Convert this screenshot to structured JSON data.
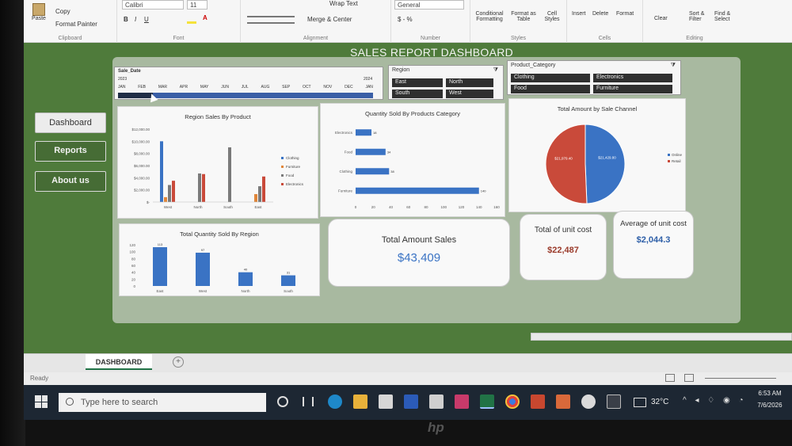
{
  "ribbon": {
    "clipboard": {
      "paste": "Paste",
      "copy": "Copy",
      "format_painter": "Format Painter",
      "label": "Clipboard"
    },
    "font": {
      "name": "Calibri",
      "size": "11",
      "label": "Font"
    },
    "alignment": {
      "wrap": "Wrap Text",
      "merge": "Merge & Center",
      "label": "Alignment"
    },
    "number": {
      "format": "General",
      "label": "Number"
    },
    "styles": {
      "conditional": "Conditional Formatting",
      "format_table": "Format as Table",
      "cell_styles": "Cell Styles",
      "label": "Styles"
    },
    "cells": {
      "insert": "Insert",
      "delete": "Delete",
      "format": "Format",
      "label": "Cells"
    },
    "editing": {
      "clear": "Clear",
      "sort": "Sort & Filter",
      "find": "Find & Select",
      "label": "Editing"
    }
  },
  "dashboard_title": "SALES REPORT DASHBOARD",
  "nav": [
    {
      "label": "Dashboard"
    },
    {
      "label": "Reports"
    },
    {
      "label": "About us"
    }
  ],
  "timeline": {
    "field": "Sale_Date",
    "year_left": "2023",
    "year_right": "2024",
    "months": [
      "JAN",
      "FEB",
      "MAR",
      "APR",
      "MAY",
      "JUN",
      "JUL",
      "AUG",
      "SEP",
      "OCT",
      "NOV",
      "DEC",
      "JAN"
    ]
  },
  "region_slicer": {
    "title": "Region",
    "items": [
      "East",
      "North",
      "South",
      "West"
    ]
  },
  "category_slicer": {
    "title": "Product_Category",
    "items": [
      "Clothing",
      "Electronics",
      "Food",
      "Furniture"
    ]
  },
  "colors": {
    "blue": "#3a73c4",
    "orange": "#e0863a",
    "gray": "#7a7a7a",
    "red": "#c94a3a",
    "green": "#4f7b3b"
  },
  "chart_data": [
    {
      "type": "bar",
      "title": "Region Sales By Product",
      "categories": [
        "West",
        "North",
        "South",
        "East"
      ],
      "series": [
        {
          "name": "Clothing",
          "values": [
            10000,
            0,
            0,
            0
          ]
        },
        {
          "name": "Furniture",
          "values": [
            800,
            0,
            0,
            1300
          ]
        },
        {
          "name": "Food",
          "values": [
            2800,
            4700,
            9000,
            2600
          ]
        },
        {
          "name": "Electronics",
          "values": [
            3500,
            4600,
            0,
            4200
          ]
        }
      ],
      "y_ticks": [
        "$12,000.00",
        "$10,000.00",
        "$8,000.00",
        "$6,000.00",
        "$4,000.00",
        "$2,000.00",
        "$-"
      ],
      "ylim": [
        0,
        12000
      ]
    },
    {
      "type": "bar",
      "title": "Quantity Sold By Products Category",
      "orientation": "horizontal",
      "categories": [
        "Electronics",
        "Food",
        "Clothing",
        "Furniture"
      ],
      "values": [
        18,
        34,
        38,
        140
      ],
      "x_ticks": [
        "0",
        "20",
        "40",
        "60",
        "80",
        "100",
        "120",
        "140",
        "160"
      ],
      "xlim": [
        0,
        160
      ]
    },
    {
      "type": "pie",
      "title": "Total Amount by Sale Channel",
      "labels": [
        "Online",
        "Retail"
      ],
      "values": [
        21429.8,
        21979.4
      ],
      "data_labels": [
        "$21,429.80",
        "$21,979.40"
      ]
    },
    {
      "type": "bar",
      "title": "Total Quantity Sold By Region",
      "categories": [
        "East",
        "West",
        "North",
        "South"
      ],
      "values": [
        113,
        97,
        40,
        31
      ],
      "y_ticks": [
        "120",
        "100",
        "80",
        "60",
        "40",
        "20",
        "0"
      ],
      "ylim": [
        0,
        120
      ]
    }
  ],
  "kpis": [
    {
      "title": "Total Amount Sales",
      "value": "$43,409"
    },
    {
      "title": "Total of unit cost",
      "value": "$22,487"
    },
    {
      "title": "Average of unit cost",
      "value": "$2,044.3"
    }
  ],
  "sheet_tab": "DASHBOARD",
  "status": "Ready",
  "taskbar": {
    "search_placeholder": "Type here to search",
    "temp": "32°C",
    "time": "6:53 AM",
    "date": "7/6/2026"
  },
  "brand": "hp"
}
